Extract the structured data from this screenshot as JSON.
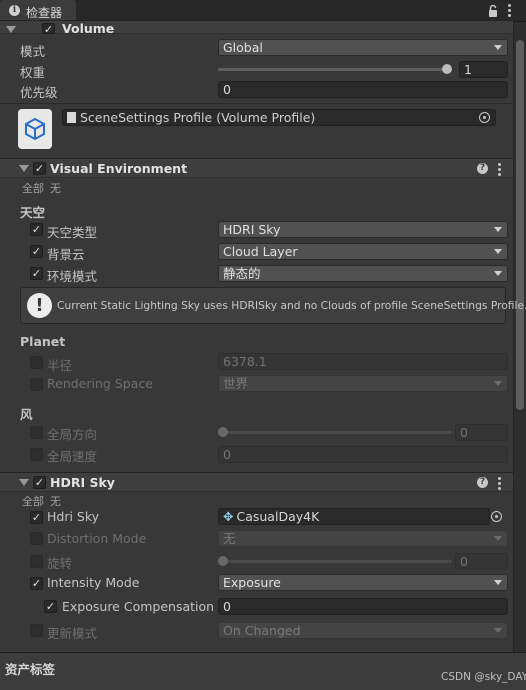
{
  "tab": {
    "icon": "info-icon",
    "label": "检查器"
  },
  "volume": {
    "title": "Volume",
    "mode_label": "模式",
    "mode_value": "Global",
    "weight_label": "权重",
    "weight_value": "1",
    "weight_fraction": 1.0,
    "priority_label": "优先级",
    "priority_value": "0",
    "profile_value": "SceneSettings Profile (Volume Profile)"
  },
  "visual_env": {
    "title": "Visual Environment",
    "all_label": "全部",
    "none_label": "无",
    "sky_heading": "天空",
    "sky_type_label": "天空类型",
    "sky_type_value": "HDRI Sky",
    "clouds_label": "背景云",
    "clouds_value": "Cloud Layer",
    "ambient_label": "环境模式",
    "ambient_value": "静态的",
    "help_text": "Current Static Lighting Sky uses HDRISky and no Clouds of profile SceneSettings Profile.",
    "planet_heading": "Planet",
    "radius_label": "半径",
    "radius_value": "6378.1",
    "rendering_space_label": "Rendering Space",
    "rendering_space_value": "世界",
    "wind_heading": "风",
    "global_dir_label": "全局方向",
    "global_dir_value": "0",
    "global_dir_fraction": 0.0,
    "global_speed_label": "全局速度",
    "global_speed_value": "0"
  },
  "hdri_sky": {
    "title": "HDRI Sky",
    "all_label": "全部",
    "none_label": "无",
    "hdri_label": "Hdri Sky",
    "hdri_value": "CasualDay4K",
    "distortion_label": "Distortion Mode",
    "distortion_value": "无",
    "rotation_label": "旋转",
    "rotation_value": "0",
    "rotation_fraction": 0.0,
    "intensity_label": "Intensity Mode",
    "intensity_value": "Exposure",
    "exposure_label": "Exposure Compensation",
    "exposure_value": "0",
    "update_label": "更新模式",
    "update_value": "On Changed"
  },
  "bottom": {
    "label": "资产标签"
  },
  "watermark": "CSDN @sky_DAYs"
}
